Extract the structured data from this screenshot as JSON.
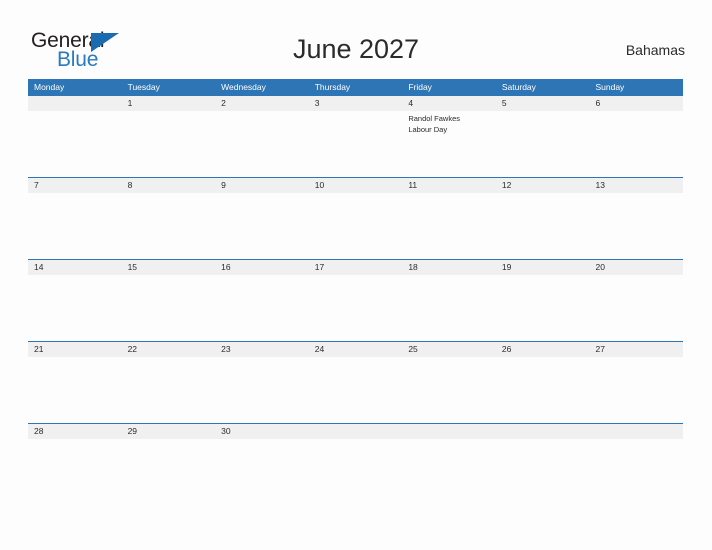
{
  "brand": {
    "name_part1": "General",
    "name_part2": "Blue",
    "triangle_color": "#1b6bb0",
    "blue_color": "#2a7ac0"
  },
  "header": {
    "title": "June 2027",
    "region": "Bahamas"
  },
  "theme": {
    "header_blue": "#2e75b6",
    "date_strip_gray": "#f0f0f0",
    "page_background": "#fdfdfd",
    "text_color": "#2b2b2b"
  },
  "weekdays": [
    "Monday",
    "Tuesday",
    "Wednesday",
    "Thursday",
    "Friday",
    "Saturday",
    "Sunday"
  ],
  "weeks": [
    {
      "days": [
        {
          "date": "",
          "events": []
        },
        {
          "date": "1",
          "events": []
        },
        {
          "date": "2",
          "events": []
        },
        {
          "date": "3",
          "events": []
        },
        {
          "date": "4",
          "events": [
            "Randol Fawkes",
            "Labour Day"
          ]
        },
        {
          "date": "5",
          "events": []
        },
        {
          "date": "6",
          "events": []
        }
      ]
    },
    {
      "days": [
        {
          "date": "7",
          "events": []
        },
        {
          "date": "8",
          "events": []
        },
        {
          "date": "9",
          "events": []
        },
        {
          "date": "10",
          "events": []
        },
        {
          "date": "11",
          "events": []
        },
        {
          "date": "12",
          "events": []
        },
        {
          "date": "13",
          "events": []
        }
      ]
    },
    {
      "days": [
        {
          "date": "14",
          "events": []
        },
        {
          "date": "15",
          "events": []
        },
        {
          "date": "16",
          "events": []
        },
        {
          "date": "17",
          "events": []
        },
        {
          "date": "18",
          "events": []
        },
        {
          "date": "19",
          "events": []
        },
        {
          "date": "20",
          "events": []
        }
      ]
    },
    {
      "days": [
        {
          "date": "21",
          "events": []
        },
        {
          "date": "22",
          "events": []
        },
        {
          "date": "23",
          "events": []
        },
        {
          "date": "24",
          "events": []
        },
        {
          "date": "25",
          "events": []
        },
        {
          "date": "26",
          "events": []
        },
        {
          "date": "27",
          "events": []
        }
      ]
    },
    {
      "days": [
        {
          "date": "28",
          "events": []
        },
        {
          "date": "29",
          "events": []
        },
        {
          "date": "30",
          "events": []
        },
        {
          "date": "",
          "events": []
        },
        {
          "date": "",
          "events": []
        },
        {
          "date": "",
          "events": []
        },
        {
          "date": "",
          "events": []
        }
      ]
    }
  ]
}
